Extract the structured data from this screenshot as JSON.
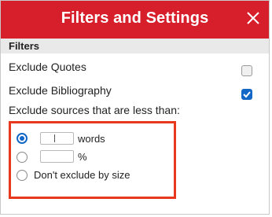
{
  "dialog": {
    "title": "Filters and Settings",
    "close_icon": "close-icon",
    "header_color": "#d71e2b"
  },
  "filters": {
    "section_label": "Filters",
    "exclude_quotes": {
      "label": "Exclude Quotes",
      "checked": false
    },
    "exclude_bibliography": {
      "label": "Exclude Bibliography",
      "checked": true
    },
    "exclude_small_label": "Exclude sources that are less than:"
  },
  "size_options": {
    "words": {
      "label": "words",
      "value": "",
      "selected": true
    },
    "percent": {
      "label": "%",
      "value": "",
      "selected": false
    },
    "dont_exclude": {
      "label": "Don't exclude by size",
      "selected": false
    }
  },
  "highlight_color": "#e8391f",
  "accent_color": "#1467c7"
}
